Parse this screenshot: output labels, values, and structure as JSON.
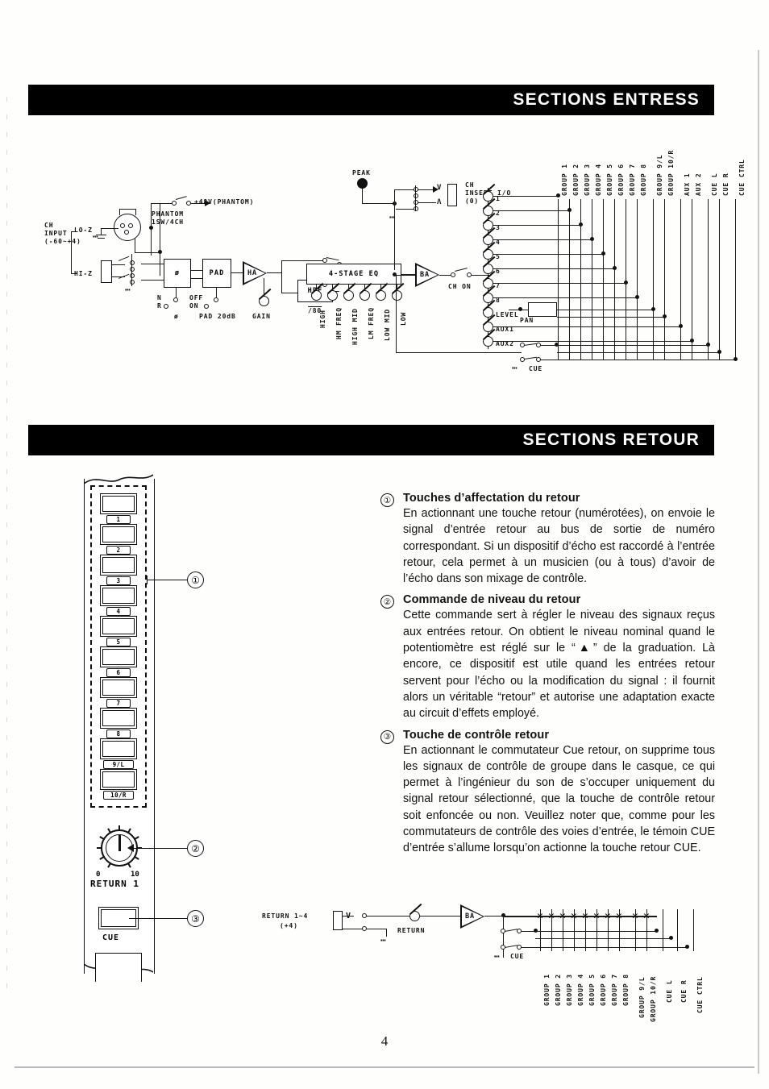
{
  "page": {
    "number": "4"
  },
  "headers": {
    "entress": "SECTIONS ENTRESS",
    "retour": "SECTIONS RETOUR"
  },
  "input_block_diagram": {
    "input_label": "CH\nINPUT\n(-60~+4)",
    "impedance_hi": "HI-Z",
    "impedance_lo": "LO-Z",
    "phantom_supply": "+48V(PHANTOM)",
    "phantom_switch": "PHANTOM\n1SW/4CH",
    "phase_box": "ø",
    "phase_label": "ø",
    "phase_positions": [
      "N",
      "R"
    ],
    "pad_box": "PAD",
    "pad_label": "PAD 20dB",
    "pad_positions": [
      "OFF",
      "ON"
    ],
    "ha_box": "HA",
    "gain_label": "GAIN",
    "hpf_box": "HPF",
    "hpf_freq": "/80",
    "eq_box": "4-STAGE EQ",
    "eq_controls": [
      "HIGH",
      "HM FREQ",
      "HIGH MID",
      "LM FREQ",
      "LOW MID",
      "LOW"
    ],
    "peak_label": "PEAK",
    "insert_label": "CH\nINSERT I/O\n(0)",
    "ba_box": "BA",
    "ch_on_label": "CH ON",
    "send_labels": [
      "1",
      "2",
      "3",
      "4",
      "5",
      "6",
      "7",
      "8",
      "LEVEL",
      "AUX1",
      "AUX2"
    ],
    "pan_label": "PAN",
    "cue_label": "CUE",
    "bus_labels": [
      "GROUP 1",
      "GROUP 2",
      "GROUP 3",
      "GROUP 4",
      "GROUP 5",
      "GROUP 6",
      "GROUP 7",
      "GROUP 8",
      "GROUP 9/L",
      "GROUP 10/R",
      "AUX 1",
      "AUX 2",
      "CUE L",
      "CUE R",
      "CUE CTRL"
    ]
  },
  "return_panel": {
    "assign_buttons": [
      "1",
      "2",
      "3",
      "4",
      "5",
      "6",
      "7",
      "8",
      "9/L",
      "10/R"
    ],
    "knob_scale_min": "0",
    "knob_scale_max": "10",
    "knob_label": "RETURN 1",
    "cue_button_label": "CUE",
    "callouts": [
      "①",
      "②",
      "③"
    ]
  },
  "text": {
    "items": [
      {
        "num": "①",
        "title": "Touches d’affectation du retour",
        "body": "En actionnant une touche retour (numérotées), on envoie le signal d’entrée retour au bus de sortie de numéro correspondant. Si un dispositif d’écho est raccordé à l’entrée retour, cela permet à un musicien (ou à tous) d’avoir de l’écho dans son mixage de contrôle."
      },
      {
        "num": "②",
        "title": "Commande de niveau du retour",
        "body": "Cette commande sert à régler le niveau des signaux reçus aux entrées retour. On obtient le niveau nominal quand le potentiomètre est réglé sur le “▲” de la graduation. Là encore, ce dispositif est utile quand les entrées retour servent pour l’écho ou la modification du signal : il fournit alors un véritable “retour” et autorise une adaptation exacte au circuit d’effets employé."
      },
      {
        "num": "③",
        "title": "Touche de contrôle retour",
        "body": "En actionnant le commutateur Cue retour, on supprime tous les signaux de contrôle de groupe dans le casque, ce qui permet à l’ingénieur du son de s’occuper uniquement du signal retour sélectionné, que la touche de contrôle retour soit enfoncée ou non. Veuillez noter que, comme pour les commutateurs de contrôle des voies d’entrée, le témoin CUE d’entrée s’allume lorsqu’on actionne la touche retour CUE."
      }
    ]
  },
  "return_block_diagram": {
    "input_label": "RETURN 1~4",
    "input_level": "(+4)",
    "return_pot_label": "RETURN",
    "ba_box": "BA",
    "cue_label": "CUE",
    "bus_labels": [
      "GROUP 1",
      "GROUP 2",
      "GROUP 3",
      "GROUP 4",
      "GROUP 5",
      "GROUP 6",
      "GROUP 7",
      "GROUP 8",
      "GROUP 9/L",
      "GROUP 10/R",
      "CUE L",
      "CUE R",
      "CUE CTRL"
    ]
  }
}
